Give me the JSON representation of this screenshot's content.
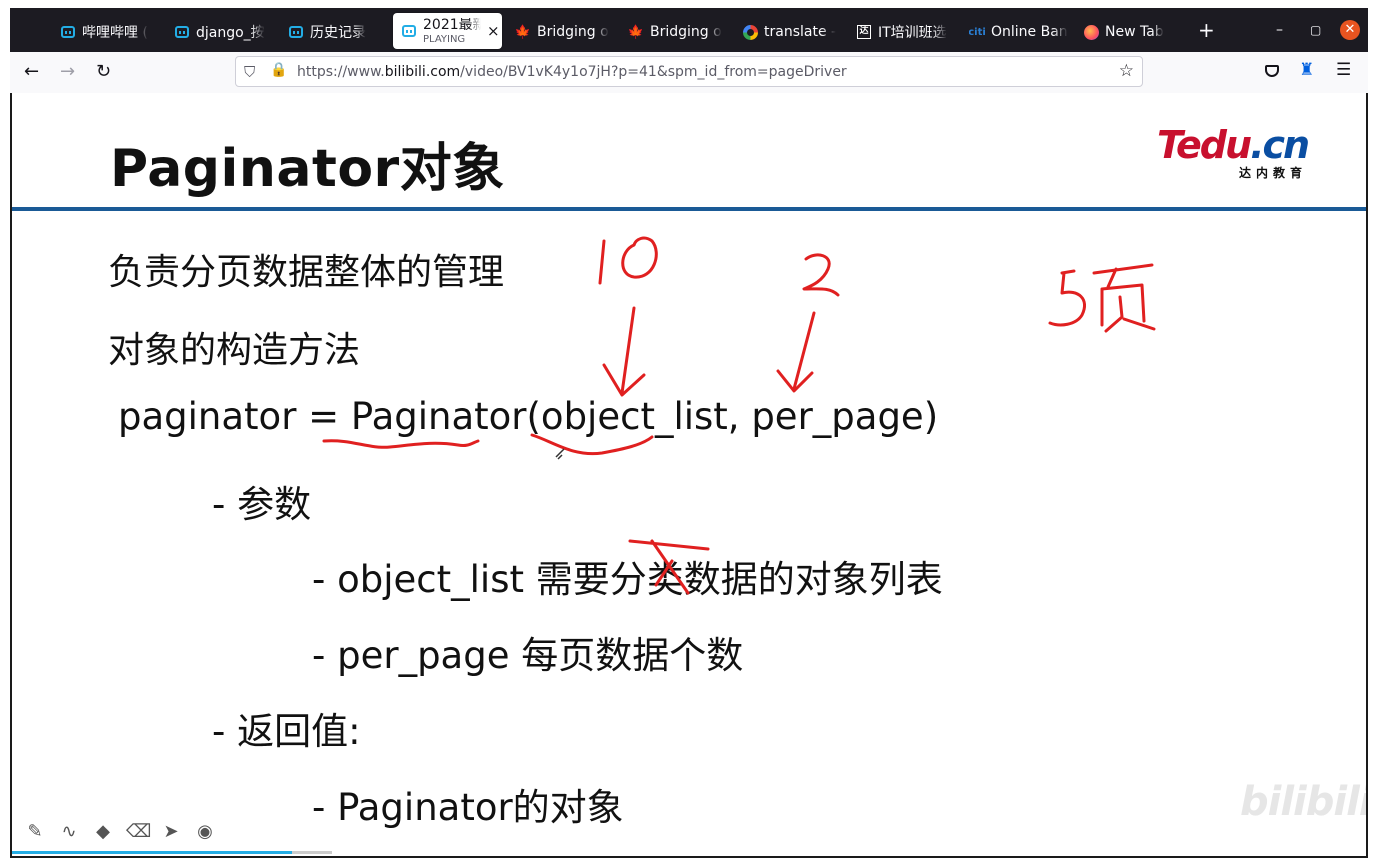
{
  "browser": {
    "tabs": [
      {
        "label": "哔哩哔哩 (",
        "icon": "bilibili-icon"
      },
      {
        "label": "django_按",
        "icon": "bilibili-icon"
      },
      {
        "label": "历史记录",
        "icon": "bilibili-icon"
      },
      {
        "label": "2021最新",
        "sublabel": "PLAYING",
        "icon": "bilibili-icon",
        "active": true
      },
      {
        "label": "Bridging o",
        "icon": "maple-leaf-icon"
      },
      {
        "label": "Bridging o",
        "icon": "maple-leaf-icon"
      },
      {
        "label": "translate -",
        "icon": "google-icon"
      },
      {
        "label": "IT培训班选",
        "icon": "it-site-icon"
      },
      {
        "label": "Online Ban",
        "icon": "citi-icon"
      },
      {
        "label": "New Tab",
        "icon": "firefox-icon"
      }
    ],
    "new_tab_glyph": "+",
    "url_prefix": "https://www.",
    "url_domain": "bilibili.com",
    "url_path": "/video/BV1vK4y1o7jH?p=41&spm_id_from=pageDriver",
    "accent": "#23ade5"
  },
  "slide": {
    "title": "Paginator对象",
    "logo_main": "Tedu",
    "logo_tld": ".cn",
    "logo_sub": "达内教育",
    "lines": [
      "负责分页数据整体的管理",
      "对象的构造方法",
      "paginator = Paginator(object_list, per_page)",
      "- 参数",
      "- object_list 需要分类数据的对象列表",
      "- per_page 每页数据个数",
      "- 返回值:",
      "- Paginator的对象"
    ],
    "rule_color": "#1a5a96",
    "ink_color": "#e02020"
  },
  "player": {
    "watermark": "bilibili"
  }
}
